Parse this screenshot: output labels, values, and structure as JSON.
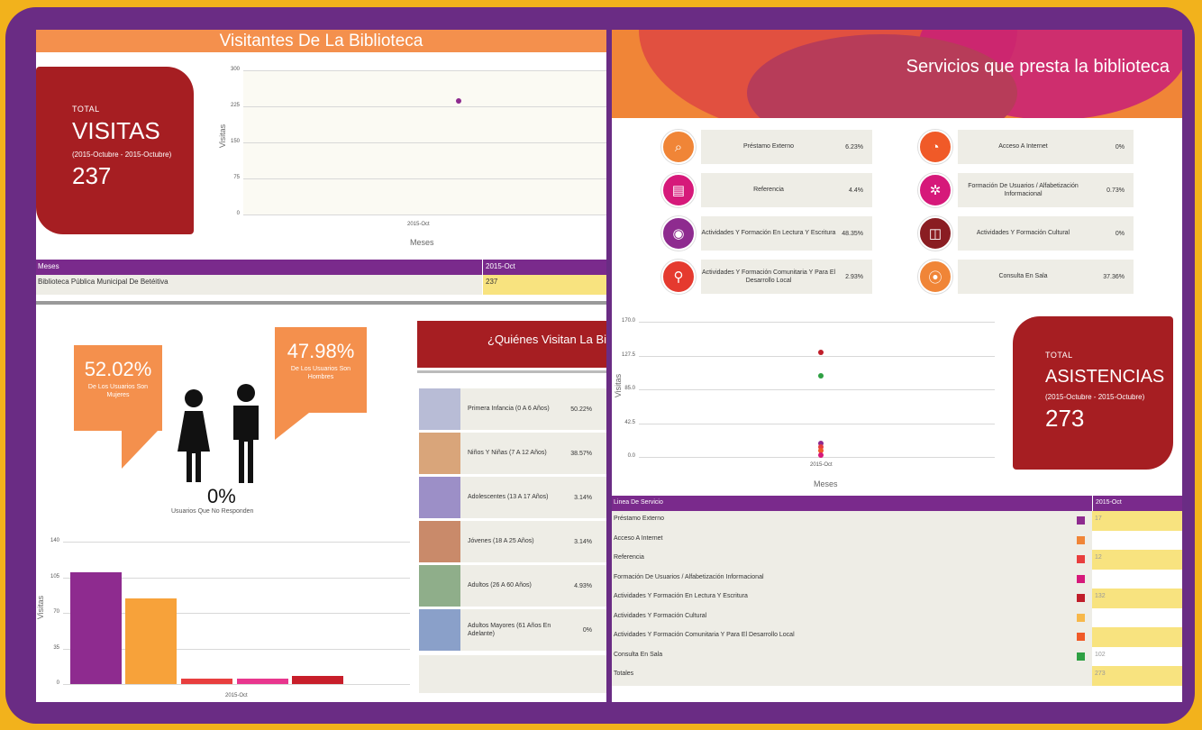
{
  "left": {
    "title": "Visitantes De La Biblioteca",
    "total_card": {
      "small": "TOTAL",
      "big": "VISITAS",
      "range": "(2015-Octubre - 2015-Octubre)",
      "number": "237"
    },
    "visits_chart": {
      "ylabel": "Visitas",
      "xlabel": "Meses",
      "yticks": [
        "300",
        "225",
        "150",
        "75",
        "0"
      ],
      "xtick": "2015-Oct"
    },
    "table": {
      "header": [
        "Meses",
        "2015-Oct"
      ],
      "row": [
        "Biblioteca Pública Municipal De Betéitiva",
        "237"
      ]
    },
    "female": {
      "pct": "52.02%",
      "sub": "De Los Usuarios Son Mujeres"
    },
    "male": {
      "pct": "47.98%",
      "sub": "De Los Usuarios Son Hombres"
    },
    "no_response": {
      "pct": "0%",
      "label": "Usuarios Que No Responden"
    },
    "bar_chart": {
      "ylabel": "Visitas",
      "yticks": [
        "140",
        "105",
        "70",
        "35",
        "0"
      ],
      "xtick": "2015-Oct"
    },
    "who": {
      "header": "¿Quiénes Visitan La Bi",
      "rows": [
        {
          "label": "Primera Infancia (0 A 6 Años)",
          "pct": "50.22%"
        },
        {
          "label": "Niños Y Niñas (7 A 12 Años)",
          "pct": "38.57%"
        },
        {
          "label": "Adolescentes (13 A 17 Años)",
          "pct": "3.14%"
        },
        {
          "label": "Jóvenes (18 A 25 Años)",
          "pct": "3.14%"
        },
        {
          "label": "Adultos (26 A 60 Años)",
          "pct": "4.93%"
        },
        {
          "label": "Adultos Mayores (61 Años En Adelante)",
          "pct": "0%"
        }
      ]
    }
  },
  "right": {
    "title": "Servicios que presta la biblioteca",
    "services": [
      {
        "label": "Préstamo Externo",
        "pct": "6.23%",
        "icon": "magnifier-icon",
        "color": "#f08537"
      },
      {
        "label": "Acceso A Internet",
        "pct": "0%",
        "icon": "pie-chart-icon",
        "color": "#f05a28"
      },
      {
        "label": "Referencia",
        "pct": "4.4%",
        "icon": "books-icon",
        "color": "#d6197a"
      },
      {
        "label": "Formación De Usuarios / Alfabetización Informacional",
        "pct": "0.73%",
        "icon": "network-icon",
        "color": "#d6197a"
      },
      {
        "label": "Actividades Y Formación En Lectura Y Escritura",
        "pct": "48.35%",
        "icon": "film-reel-icon",
        "color": "#8e2b8f"
      },
      {
        "label": "Actividades Y Formación Cultural",
        "pct": "0%",
        "icon": "mouse-icon",
        "color": "#8a1d22"
      },
      {
        "label": "Actividades Y Formación Comunitaria Y Para El Desarrollo Local",
        "pct": "2.93%",
        "icon": "antenna-icon",
        "color": "#e53a2f"
      },
      {
        "label": "Consulta En Sala",
        "pct": "37.36%",
        "icon": "location-pin-icon",
        "color": "#f08537"
      }
    ],
    "assist_chart": {
      "ylabel": "Visitas",
      "xlabel": "Meses",
      "yticks": [
        "170.0",
        "127.5",
        "85.0",
        "42.5",
        "0.0"
      ],
      "xtick": "2015-Oct"
    },
    "asis_card": {
      "small": "TOTAL",
      "big": "ASISTENCIAS",
      "range": "(2015-Octubre - 2015-Octubre)",
      "number": "273"
    },
    "table": {
      "header": [
        "Linea De Servicio",
        "2015-Oct"
      ],
      "rows": [
        {
          "label": "Préstamo Externo",
          "color": "#8e2b8f",
          "value": "17",
          "hl": true
        },
        {
          "label": "Acceso A Internet",
          "color": "#f08537",
          "value": "",
          "hl": false
        },
        {
          "label": "Referencia",
          "color": "#e83e3e",
          "value": "12",
          "hl": true
        },
        {
          "label": "Formación De Usuarios / Alfabetización Informacional",
          "color": "#d6197a",
          "value": "",
          "hl": false
        },
        {
          "label": "Actividades Y Formación En Lectura Y Escritura",
          "color": "#c01e2a",
          "value": "132",
          "hl": true
        },
        {
          "label": "Actividades Y Formación Cultural",
          "color": "#f7b84a",
          "value": "",
          "hl": false
        },
        {
          "label": "Actividades Y Formación Comunitaria Y Para El Desarrollo Local",
          "color": "#f05a28",
          "value": "",
          "hl": true
        },
        {
          "label": "Consulta En Sala",
          "color": "#2ea043",
          "value": "102",
          "hl": false
        },
        {
          "label": "Totales",
          "color": "",
          "value": "273",
          "hl": true
        }
      ]
    }
  },
  "chart_data": [
    {
      "type": "scatter",
      "x": [
        "2015-Oct"
      ],
      "series": [
        {
          "values": [
            237
          ]
        }
      ],
      "ylabel": "Visitas",
      "xlabel": "Meses",
      "ylim": [
        0,
        300
      ]
    },
    {
      "type": "bar",
      "categories": [
        "2015-Oct"
      ],
      "series": [
        {
          "values": [
            110
          ],
          "color": "#8e2b8f"
        },
        {
          "values": [
            84
          ],
          "color": "#f7a23a"
        },
        {
          "values": [
            5
          ],
          "color": "#e83e3e"
        },
        {
          "values": [
            5
          ],
          "color": "#e8368e"
        },
        {
          "values": [
            8
          ],
          "color": "#c81e2a"
        }
      ],
      "ylabel": "Visitas",
      "ylim": [
        0,
        140
      ]
    },
    {
      "type": "scatter",
      "x": [
        "2015-Oct"
      ],
      "series": [
        {
          "values": [
            132
          ],
          "color": "#c01e2a"
        },
        {
          "values": [
            102
          ],
          "color": "#2ea043"
        },
        {
          "values": [
            17
          ],
          "color": "#8e2b8f"
        },
        {
          "values": [
            12
          ],
          "color": "#e83e3e"
        },
        {
          "values": [
            8
          ],
          "color": "#f05a28"
        },
        {
          "values": [
            2
          ],
          "color": "#d6197a"
        }
      ],
      "ylabel": "Visitas",
      "xlabel": "Meses",
      "ylim": [
        0,
        170
      ]
    }
  ]
}
